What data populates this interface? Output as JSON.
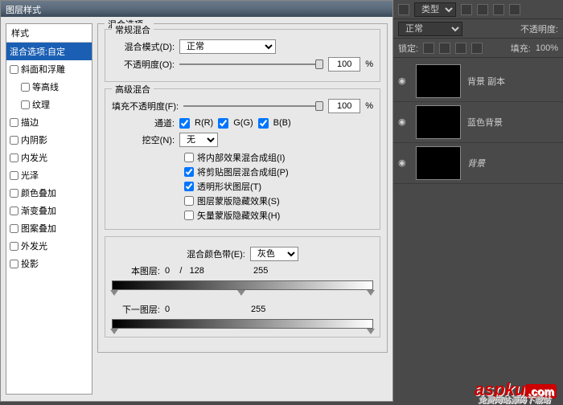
{
  "dialog": {
    "title": "图层样式",
    "styles_header": "样式",
    "styles": [
      {
        "label": "混合选项:自定",
        "checkbox": false,
        "selected": true,
        "sub": false
      },
      {
        "label": "斜面和浮雕",
        "checkbox": true,
        "checked": false,
        "sub": false
      },
      {
        "label": "等高线",
        "checkbox": true,
        "checked": false,
        "sub": true
      },
      {
        "label": "纹理",
        "checkbox": true,
        "checked": false,
        "sub": true
      },
      {
        "label": "描边",
        "checkbox": true,
        "checked": false,
        "sub": false
      },
      {
        "label": "内阴影",
        "checkbox": true,
        "checked": false,
        "sub": false
      },
      {
        "label": "内发光",
        "checkbox": true,
        "checked": false,
        "sub": false
      },
      {
        "label": "光泽",
        "checkbox": true,
        "checked": false,
        "sub": false
      },
      {
        "label": "颜色叠加",
        "checkbox": true,
        "checked": false,
        "sub": false
      },
      {
        "label": "渐变叠加",
        "checkbox": true,
        "checked": false,
        "sub": false
      },
      {
        "label": "图案叠加",
        "checkbox": true,
        "checked": false,
        "sub": false
      },
      {
        "label": "外发光",
        "checkbox": true,
        "checked": false,
        "sub": false
      },
      {
        "label": "投影",
        "checkbox": true,
        "checked": false,
        "sub": false
      }
    ],
    "blend_options_title": "混合选项",
    "general_blend_title": "常规混合",
    "blend_mode_label": "混合模式(D):",
    "blend_mode_value": "正常",
    "opacity_label": "不透明度(O):",
    "opacity_value": "100",
    "percent": "%",
    "advanced_blend_title": "高级混合",
    "fill_opacity_label": "填充不透明度(F):",
    "fill_opacity_value": "100",
    "channels_label": "通道:",
    "ch_r": "R(R)",
    "ch_g": "G(G)",
    "ch_b": "B(B)",
    "knockout_label": "挖空(N):",
    "knockout_value": "无",
    "cb1": "将内部效果混合成组(I)",
    "cb2": "将剪贴图层混合成组(P)",
    "cb3": "透明形状图层(T)",
    "cb4": "图层蒙版隐藏效果(S)",
    "cb5": "矢量蒙版隐藏效果(H)",
    "blend_if_label": "混合颜色带(E):",
    "blend_if_value": "灰色",
    "this_layer_label": "本图层:",
    "this_layer_vals": "0    /   128                    255",
    "under_layer_label": "下一图层:",
    "under_layer_vals": "0                                 255"
  },
  "panel": {
    "type_label": "类型",
    "blend_mode": "正常",
    "opacity_label": "不透明度:",
    "lock_label": "锁定:",
    "fill_label": "填充:",
    "fill_value": "100%",
    "layers": [
      {
        "name": "背景 副本",
        "thumb": "fire"
      },
      {
        "name": "蓝色背景",
        "thumb": "blue"
      },
      {
        "name": "背景",
        "thumb": "fire",
        "italic": true
      }
    ]
  },
  "watermark": {
    "brand": "aspku",
    "com": ".com",
    "sub": "免费网站源码下载站"
  }
}
